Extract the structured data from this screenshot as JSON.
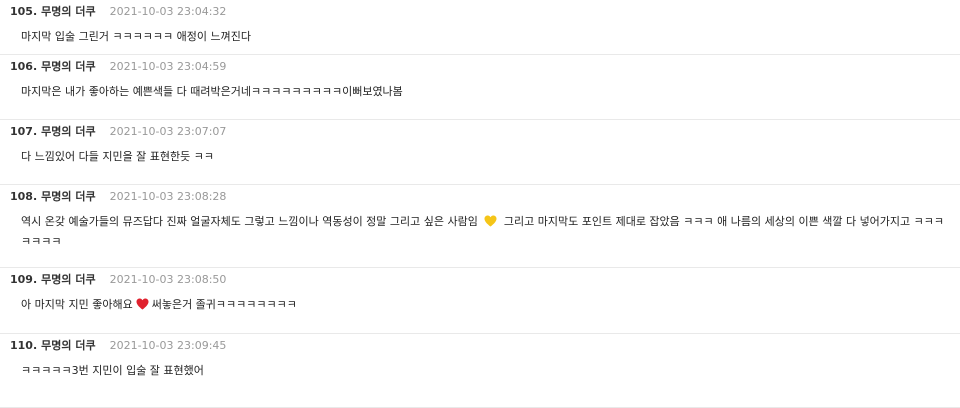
{
  "comments": [
    {
      "number": "105.",
      "author": "무명의 더쿠",
      "timestamp": "2021-10-03 23:04:32",
      "text": "마지막 입술 그린거 ㅋㅋㅋㅋㅋㅋ 애정이 느껴진다"
    },
    {
      "number": "106.",
      "author": "무명의 더쿠",
      "timestamp": "2021-10-03 23:04:59",
      "text": "마지막은 내가 좋아하는 예쁜색들 다 때려박은거네ㅋㅋㅋㅋㅋㅋㅋㅋㅋ이뻐보였나봄"
    },
    {
      "number": "107.",
      "author": "무명의 더쿠",
      "timestamp": "2021-10-03 23:07:07",
      "text": "다 느낌있어 다들 지민을 잘 표현한듯 ㅋㅋ"
    },
    {
      "number": "108.",
      "author": "무명의 더쿠",
      "timestamp": "2021-10-03 23:08:28",
      "text_before": "역시 온갖 예술가들의 뮤즈답다 진짜 얼굴자체도 그렇고 느낌이나 역동성이 정말 그리고 싶은 사람임",
      "emoji": "yellow-heart-icon",
      "text_after": "그리고 마지막도 포인트 제대로 잡았음 ㅋㅋㅋ 애 나름의 세상의 이쁜 색깔 다 넣어가지고 ㅋㅋㅋㅋㅋㅋㅋ"
    },
    {
      "number": "109.",
      "author": "무명의 더쿠",
      "timestamp": "2021-10-03 23:08:50",
      "text_before": "아 마지막 지민 좋아해요",
      "emoji": "red-heart-icon",
      "text_after": "써놓은거 졸귀ㅋㅋㅋㅋㅋㅋㅋㅋ"
    },
    {
      "number": "110.",
      "author": "무명의 더쿠",
      "timestamp": "2021-10-03 23:09:45",
      "text": "ㅋㅋㅋㅋㅋ3번 지민이 입술 잘 표현했어"
    }
  ],
  "colors": {
    "yellow_heart": "#f5c518",
    "red_heart": "#e0212e",
    "divider": "#e9e9e9",
    "date": "#999999"
  }
}
